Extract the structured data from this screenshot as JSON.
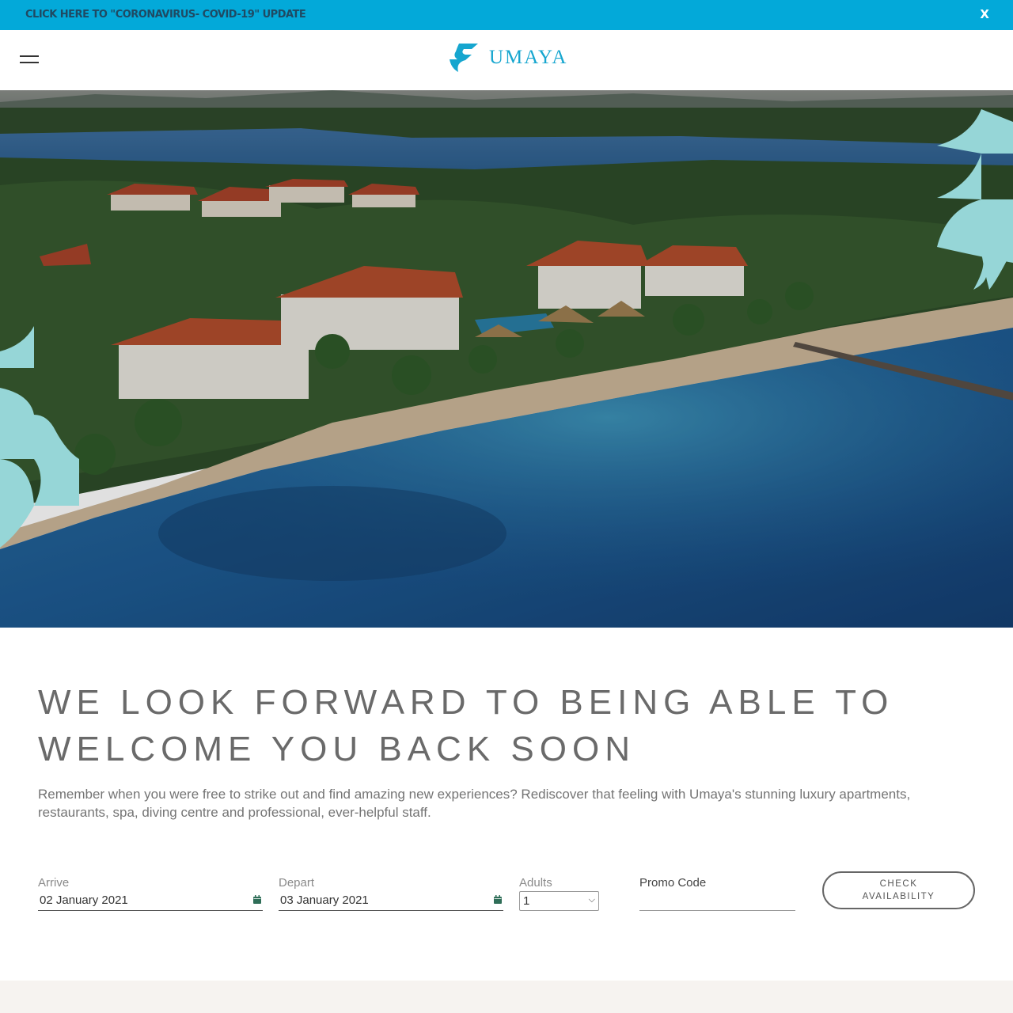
{
  "banner": {
    "link_text": "CLICK HERE TO \"CORONAVIRUS- COVID-19\" UPDATE",
    "close_label": "X"
  },
  "header": {
    "menu_icon": "hamburger-icon",
    "logo_text": "UMAYA",
    "logo_icon": "umaya-bird-logo",
    "brand_color": "#16a6cf"
  },
  "hero": {
    "image_description_icon": "resort-aerial-photo"
  },
  "main": {
    "headline_line1": "WE LOOK FORWARD TO BEING ABLE TO",
    "headline_line2": "WELCOME YOU BACK SOON",
    "intro": "Remember when you were free to strike out and find amazing new experiences? Rediscover that feeling with Umaya's stunning luxury apartments, restaurants, spa, diving centre and professional, ever-helpful staff."
  },
  "booking": {
    "arrive_label": "Arrive",
    "arrive_value": "02 January 2021",
    "depart_label": "Depart",
    "depart_value": "03 January 2021",
    "adults_label": "Adults",
    "adults_value": "1",
    "promo_label": "Promo Code",
    "promo_value": "",
    "check_line1": "CHECK",
    "check_line2": "AVAILABILITY",
    "calendar_icon": "calendar-icon",
    "accent_color": "#2f6e58"
  },
  "colors": {
    "banner_bg": "#03a9d9",
    "banner_text": "#1f4a63",
    "decor_teal": "#96d6d7",
    "footer_bg": "#f6f3f0"
  }
}
